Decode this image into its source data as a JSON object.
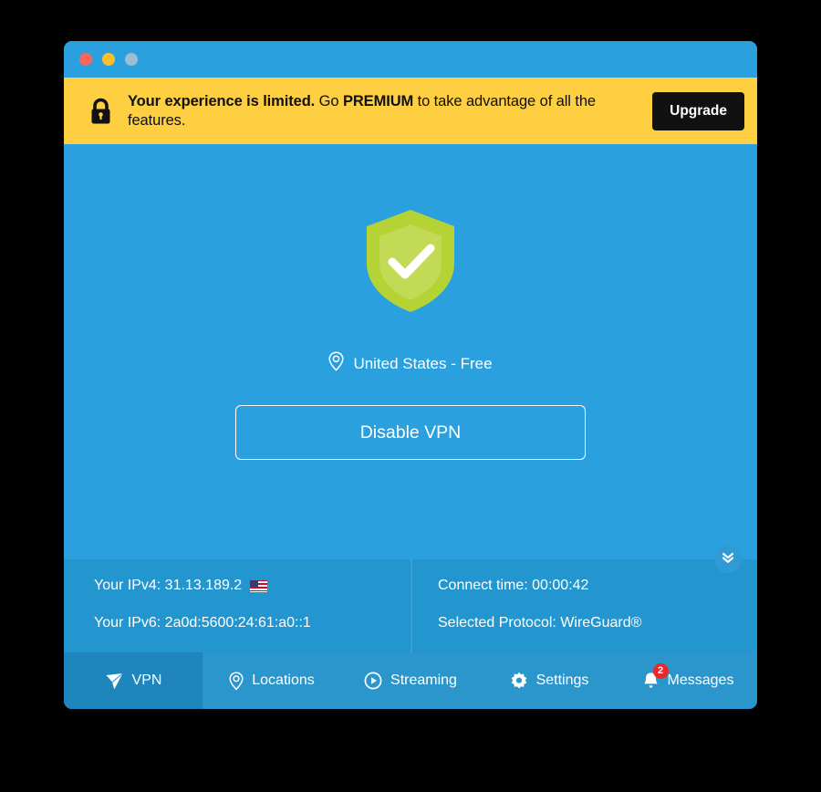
{
  "window": {
    "controls": [
      {
        "name": "close",
        "color": "#f9655f"
      },
      {
        "name": "minimize",
        "color": "#fcc02f"
      },
      {
        "name": "maximize",
        "color": "#9cbed4"
      }
    ]
  },
  "banner": {
    "icon": "lock-icon",
    "bold_lead": "Your experience is limited.",
    "mid_text": " Go ",
    "bold_premium": "PREMIUM",
    "tail_text": " to take advantage of all the features.",
    "upgrade_label": "Upgrade",
    "background": "#fdcf41"
  },
  "main": {
    "status_icon": "shield-check-icon",
    "location_icon": "map-pin-icon",
    "location_label": "United States - Free",
    "action_button_label": "Disable VPN",
    "collapse_icon": "chevron-double-down-icon"
  },
  "info": {
    "ipv4_label": "Your IPv4: 31.13.189.2",
    "ipv4_flag": "us-flag-icon",
    "ipv6_label": "Your IPv6: 2a0d:5600:24:61:a0::1",
    "connect_time_label": "Connect time: 00:00:42",
    "protocol_label": "Selected Protocol: WireGuard®"
  },
  "nav": {
    "items": [
      {
        "label": "VPN",
        "icon": "send-plane-icon",
        "active": true
      },
      {
        "label": "Locations",
        "icon": "map-pin-icon",
        "active": false
      },
      {
        "label": "Streaming",
        "icon": "play-circle-icon",
        "active": false
      },
      {
        "label": "Settings",
        "icon": "gear-icon",
        "active": false
      },
      {
        "label": "Messages",
        "icon": "bell-icon",
        "active": false,
        "badge": "2"
      }
    ]
  },
  "colors": {
    "primary_blue": "#2ba0de",
    "panel_blue": "#2496cf",
    "nav_blue": "#2b96cc",
    "nav_active_blue": "#1f86bd",
    "accent_yellow": "#fdcf41",
    "shield_outer": "#b5d334",
    "shield_inner": "#c3da57",
    "badge_red": "#e8282b"
  }
}
